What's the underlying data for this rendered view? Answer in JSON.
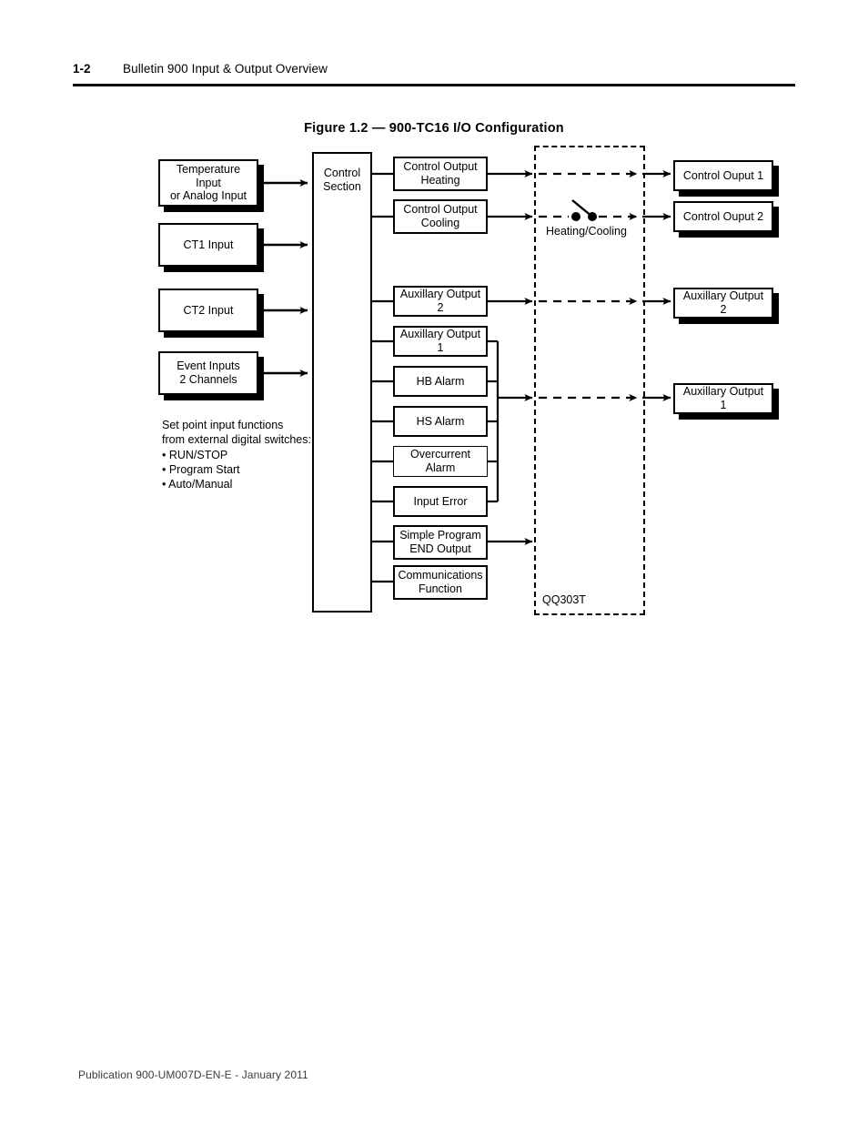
{
  "header": {
    "page_number": "1-2",
    "title": "Bulletin 900 Input & Output Overview"
  },
  "figure": {
    "caption": "Figure 1.2 — 900-TC16 I/O Configuration",
    "control_section": {
      "line1": "Control",
      "line2": "Section"
    },
    "inputs": [
      {
        "line1": "Temperature Input",
        "line2": "or Analog Input"
      },
      {
        "line1": "CT1 Input",
        "line2": ""
      },
      {
        "line1": "CT2 Input",
        "line2": ""
      },
      {
        "line1": "Event Inputs",
        "line2": "2 Channels"
      }
    ],
    "functions": [
      {
        "line1": "Control Output",
        "line2": "Heating"
      },
      {
        "line1": "Control Output",
        "line2": "Cooling"
      },
      {
        "line1": "Auxillary Output 2",
        "line2": ""
      },
      {
        "line1": "Auxillary Output 1",
        "line2": ""
      },
      {
        "line1": "HB Alarm",
        "line2": ""
      },
      {
        "line1": "HS Alarm",
        "line2": ""
      },
      {
        "line1": "Overcurrent Alarm",
        "line2": ""
      },
      {
        "line1": "Input Error",
        "line2": ""
      },
      {
        "line1": "Simple Program",
        "line2": "END Output"
      },
      {
        "line1": "Communications",
        "line2": "Function"
      }
    ],
    "module": {
      "label": "QQ303T",
      "switch_label": "Heating/Cooling"
    },
    "outputs": [
      {
        "line1": "Control Ouput 1",
        "line2": ""
      },
      {
        "line1": "Control Ouput 2",
        "line2": ""
      },
      {
        "line1": "Auxillary Output 2",
        "line2": ""
      },
      {
        "line1": "Auxillary Output 1",
        "line2": ""
      }
    ],
    "note": {
      "line1": "Set point input functions",
      "line2": "from external digital switches:",
      "line3": "• RUN/STOP",
      "line4": "• Program Start",
      "line5": "• Auto/Manual"
    }
  },
  "footer": {
    "publication": "Publication 900-UM007D-EN-E - January 2011"
  },
  "colors": {
    "ink": "#000000",
    "paper": "#ffffff",
    "footer_gray": "#3b3b3b"
  }
}
